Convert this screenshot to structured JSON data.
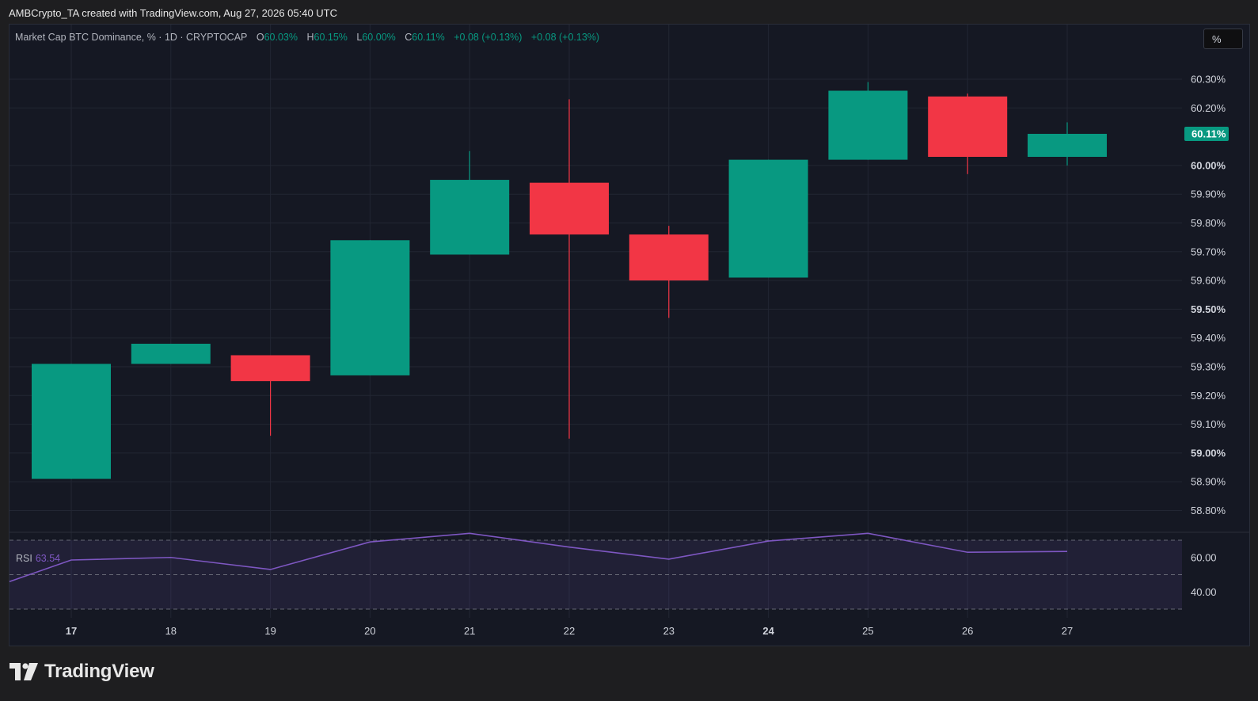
{
  "header": {
    "credit": "AMBCrypto_TA created with TradingView.com, Aug 27, 2026 05:40 UTC"
  },
  "legend": {
    "symbol": "Market Cap BTC Dominance, % · 1D · CRYPTOCAP",
    "o_label": "O",
    "o_value": "60.03%",
    "h_label": "H",
    "h_value": "60.15%",
    "l_label": "L",
    "l_value": "60.00%",
    "c_label": "C",
    "c_value": "60.11%",
    "change1": "+0.08 (+0.13%)",
    "change2": "+0.08 (+0.13%)"
  },
  "toolbar": {
    "percent_label": "%"
  },
  "rsi": {
    "name": "RSI",
    "value": "63.54"
  },
  "footer": {
    "brand": "TradingView"
  },
  "colors": {
    "up": "#089981",
    "down": "#f23645",
    "rsi_line": "#7e57c2",
    "background": "#151823",
    "grid": "#222633"
  },
  "chart_data": [
    {
      "type": "candlestick",
      "title": "Market Cap BTC Dominance, % · 1D · CRYPTOCAP",
      "x": [
        "17",
        "18",
        "19",
        "20",
        "21",
        "22",
        "23",
        "24",
        "25",
        "26",
        "27"
      ],
      "bold_ticks": [
        "17",
        "24"
      ],
      "candles": [
        {
          "x": "17",
          "open": 58.91,
          "high": 59.31,
          "low": 58.91,
          "close": 59.31
        },
        {
          "x": "18",
          "open": 59.31,
          "high": 59.38,
          "low": 59.31,
          "close": 59.38
        },
        {
          "x": "19",
          "open": 59.34,
          "high": 59.34,
          "low": 59.06,
          "close": 59.25
        },
        {
          "x": "20",
          "open": 59.27,
          "high": 59.74,
          "low": 59.27,
          "close": 59.74
        },
        {
          "x": "21",
          "open": 59.69,
          "high": 60.05,
          "low": 59.69,
          "close": 59.95
        },
        {
          "x": "22",
          "open": 59.94,
          "high": 60.23,
          "low": 59.05,
          "close": 59.76
        },
        {
          "x": "23",
          "open": 59.76,
          "high": 59.79,
          "low": 59.47,
          "close": 59.6
        },
        {
          "x": "24",
          "open": 59.61,
          "high": 60.02,
          "low": 59.61,
          "close": 60.02
        },
        {
          "x": "25",
          "open": 60.02,
          "high": 60.29,
          "low": 60.02,
          "close": 60.26
        },
        {
          "x": "26",
          "open": 60.24,
          "high": 60.25,
          "low": 59.97,
          "close": 60.03
        },
        {
          "x": "27",
          "open": 60.03,
          "high": 60.15,
          "low": 60.0,
          "close": 60.11
        }
      ],
      "y_ticks": [
        "60.30%",
        "60.20%",
        "60.11%",
        "60.00%",
        "59.90%",
        "59.80%",
        "59.70%",
        "59.60%",
        "59.50%",
        "59.40%",
        "59.30%",
        "59.20%",
        "59.10%",
        "59.00%",
        "58.90%",
        "58.80%"
      ],
      "y_tick_values": [
        60.3,
        60.2,
        60.11,
        60.0,
        59.9,
        59.8,
        59.7,
        59.6,
        59.5,
        59.4,
        59.3,
        59.2,
        59.1,
        59.0,
        58.9,
        58.8
      ],
      "bold_y_ticks": [
        "60.00%",
        "59.50%",
        "59.00%"
      ],
      "last_price": 60.11,
      "last_price_label": "60.11%",
      "ylim": [
        58.725,
        60.42
      ],
      "grid": true
    },
    {
      "type": "line",
      "title": "RSI",
      "x": [
        "16",
        "17",
        "18",
        "19",
        "20",
        "21",
        "22",
        "23",
        "24",
        "25",
        "26",
        "27"
      ],
      "values": [
        46.0,
        58.5,
        60.0,
        53.0,
        69.0,
        74.0,
        66.0,
        59.0,
        69.5,
        74.0,
        63.0,
        63.5
      ],
      "y_ticks": [
        "60.00",
        "40.00"
      ],
      "y_tick_values": [
        60,
        40
      ],
      "band": [
        30,
        70
      ],
      "ylim": [
        30,
        70
      ]
    }
  ]
}
